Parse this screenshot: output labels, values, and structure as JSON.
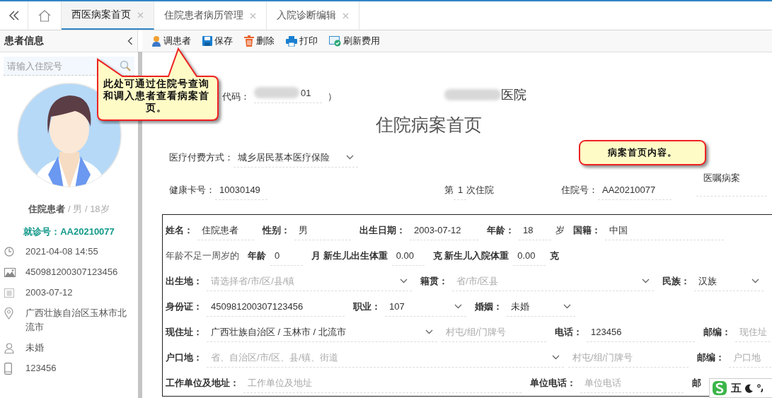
{
  "tabbar": {
    "tabs": [
      {
        "label": "西医病案首页",
        "selected": true
      },
      {
        "label": "住院患者病历管理",
        "selected": false
      },
      {
        "label": "入院诊断编辑",
        "selected": false
      }
    ]
  },
  "sidebar": {
    "title": "患者信息",
    "search": {
      "placeholder": "请输入住院号"
    },
    "patient": {
      "parts": [
        "住院患者",
        "/",
        "男",
        "/",
        "18岁"
      ]
    },
    "visit_no": "就诊号：AA20210077",
    "info": [
      {
        "kind": "clock",
        "text": "2021-04-08 14:55"
      },
      {
        "kind": "id",
        "text": "450981200307123456"
      },
      {
        "kind": "calendar",
        "text": "2003-07-12"
      },
      {
        "kind": "location",
        "text": "广西壮族自治区玉林市北流市"
      },
      {
        "kind": "person",
        "text": "未婚"
      },
      {
        "kind": "phone",
        "text": "123456"
      }
    ]
  },
  "toolbar": [
    {
      "kind": "patient",
      "label": "调患者"
    },
    {
      "kind": "save",
      "label": "保存"
    },
    {
      "kind": "delete",
      "label": "删除"
    },
    {
      "kind": "print",
      "label": "打印"
    },
    {
      "kind": "refresh",
      "label": "刷新费用"
    }
  ],
  "header": {
    "code_label": "代码：",
    "code_value": "01",
    "code_close": "）",
    "hospital_suffix": "医院",
    "title": "住院病案首页"
  },
  "payment": {
    "label": "医疗付费方式：",
    "value": "城乡居民基本医疗保险"
  },
  "meta": [
    {
      "kind": "field",
      "label": "健康卡号：",
      "value": "10030149"
    },
    {
      "kind": "count",
      "prefix": "第",
      "value": "1",
      "suffix": "次住院"
    },
    {
      "kind": "field",
      "label": "住院号：",
      "value": "AA20210077"
    },
    {
      "kind": "heading",
      "label": "医嘱病案"
    }
  ],
  "form": {
    "lines": [
      {
        "items": [
          {
            "kind": "label",
            "text": "姓名："
          },
          {
            "kind": "text",
            "value": "住院患者"
          },
          {
            "kind": "label",
            "text": "性别："
          },
          {
            "kind": "text",
            "value": "男"
          },
          {
            "kind": "label",
            "text": "出生日期："
          },
          {
            "kind": "text",
            "value": "2003-07-12"
          },
          {
            "kind": "label",
            "text": "年龄："
          },
          {
            "kind": "text",
            "value": "18"
          },
          {
            "kind": "unit",
            "text": "岁",
            "bold": false
          },
          {
            "kind": "label",
            "text": "国籍："
          },
          {
            "kind": "text",
            "value": "中国"
          }
        ]
      },
      {
        "items": [
          {
            "kind": "note",
            "text": "年龄不足一周岁的"
          },
          {
            "kind": "label",
            "text": "年龄"
          },
          {
            "kind": "text",
            "value": "0"
          },
          {
            "kind": "label",
            "text": "月 新生儿出生体重"
          },
          {
            "kind": "text",
            "value": "0.00"
          },
          {
            "kind": "label",
            "text": "克 新生儿入院体重"
          },
          {
            "kind": "text",
            "value": "0.00"
          },
          {
            "kind": "unit",
            "text": "克",
            "bold": true
          }
        ]
      },
      {
        "items": [
          {
            "kind": "label",
            "text": "出生地："
          },
          {
            "kind": "select",
            "placeholder": "请选择省/市/区/县/镇"
          },
          {
            "kind": "label",
            "text": "籍贯："
          },
          {
            "kind": "select",
            "placeholder": "省/市/区县"
          },
          {
            "kind": "label",
            "text": "民族："
          },
          {
            "kind": "select",
            "value": "汉族"
          }
        ]
      },
      {
        "items": [
          {
            "kind": "label",
            "text": "身份证："
          },
          {
            "kind": "text",
            "value": "450981200307123456"
          },
          {
            "kind": "label",
            "text": "职业："
          },
          {
            "kind": "select",
            "value": "107"
          },
          {
            "kind": "label",
            "text": "婚姻："
          },
          {
            "kind": "select",
            "value": "未婚"
          }
        ]
      },
      {
        "items": [
          {
            "kind": "label",
            "text": "现住址："
          },
          {
            "kind": "select",
            "value": "广西壮族自治区 / 玉林市 / 北流市"
          },
          {
            "kind": "text",
            "placeholder": "村屯/组/门牌号"
          },
          {
            "kind": "label",
            "text": "电话："
          },
          {
            "kind": "text",
            "value": "123456"
          },
          {
            "kind": "label",
            "text": "邮编："
          },
          {
            "kind": "text",
            "placeholder": "现住址"
          }
        ]
      },
      {
        "items": [
          {
            "kind": "label",
            "text": "户口地："
          },
          {
            "kind": "select",
            "placeholder": "省、自治区/市/区、县/镇、街道"
          },
          {
            "kind": "text",
            "placeholder": "村屯/组/门牌号"
          },
          {
            "kind": "label",
            "text": "邮编："
          },
          {
            "kind": "text",
            "placeholder": "户口地"
          }
        ]
      },
      {
        "items": [
          {
            "kind": "label",
            "text": "工作单位及地址："
          },
          {
            "kind": "text",
            "placeholder": "工作单位及地址"
          },
          {
            "kind": "label",
            "text": "单位电话："
          },
          {
            "kind": "text",
            "placeholder": "单位电话"
          },
          {
            "kind": "label",
            "text": "邮"
          }
        ]
      }
    ]
  },
  "callouts": [
    {
      "text": "此处可通过住院号查询和调入患者查看病案首页。"
    },
    {
      "text": "病案首页内容。"
    }
  ],
  "ime": {
    "mode": "五"
  }
}
